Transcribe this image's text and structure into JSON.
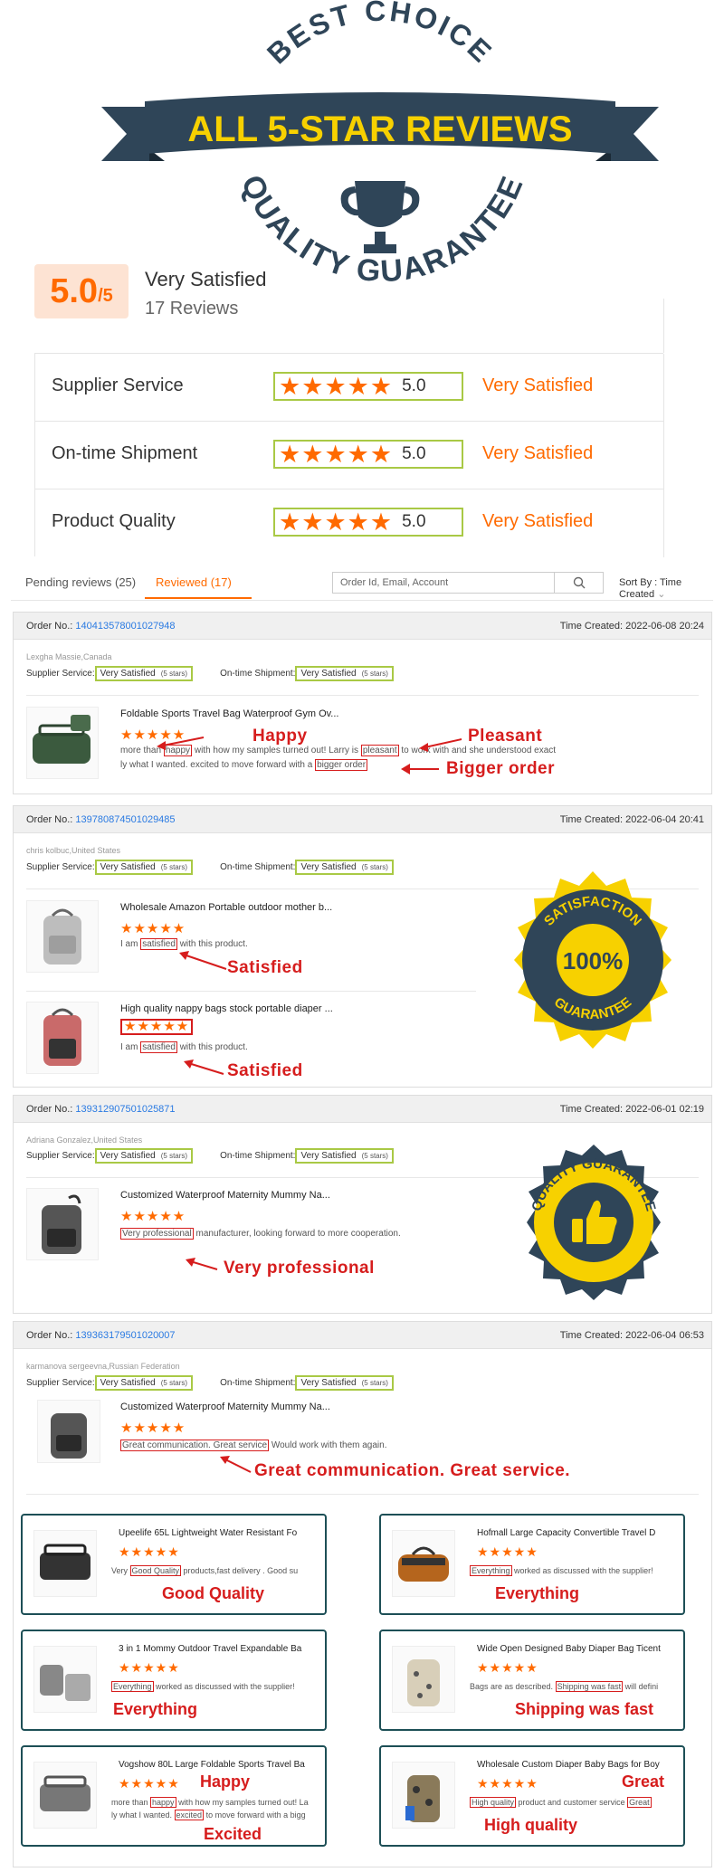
{
  "banner": {
    "arc_top": "BEST CHOICE",
    "ribbon": "ALL 5-STAR REVIEWS",
    "arc_bottom": "QUALITY GUARANTEE"
  },
  "summary": {
    "score": "5.0",
    "out_of": "/5",
    "label": "Very Satisfied",
    "count": "17 Reviews",
    "rows": [
      {
        "label": "Supplier Service",
        "value": "5.0",
        "word": "Very Satisfied",
        "stars": 5
      },
      {
        "label": "On-time Shipment",
        "value": "5.0",
        "word": "Very Satisfied",
        "stars": 5
      },
      {
        "label": "Product Quality",
        "value": "5.0",
        "word": "Very Satisfied",
        "stars": 5
      }
    ]
  },
  "toolbar": {
    "tab_pending": "Pending reviews (25)",
    "tab_reviewed": "Reviewed (17)",
    "search_placeholder": "Order Id, Email, Account",
    "sort_label": "Sort By : Time Created"
  },
  "common": {
    "order_no_label": "Order No.:",
    "time_label": "Time Created:",
    "supplier_service": "Supplier Service:",
    "ontime": "On-time Shipment:",
    "very_satisfied": "Very Satisfied",
    "five_stars": "(5 stars)",
    "stars": "★★★★★"
  },
  "orders": [
    {
      "id": "140413578001027948",
      "time": "2022-06-08 20:24",
      "buyer": "Lexgha Massie,Canada",
      "products": [
        {
          "title": "Foldable Sports Travel Bag Waterproof Gym Ov...",
          "t1a": "more than ",
          "h1": "happy",
          "t1b": " with how my samples turned out! Larry is ",
          "h2": "pleasant",
          "t1c": " to work with and she understood exact",
          "t2a": "ly what I wanted. excited to move forward with a ",
          "h3": "bigger order"
        }
      ],
      "annos": [
        "Happy",
        "Pleasant",
        "Bigger order"
      ]
    },
    {
      "id": "139780874501029485",
      "time": "2022-06-04 20:41",
      "buyer": "chris kolbuc,United States",
      "products": [
        {
          "title": "Wholesale Amazon Portable outdoor mother b...",
          "ta": "I am ",
          "h1": "satisfied",
          "tb": " with this product."
        },
        {
          "title": "High quality nappy bags stock portable diaper ...",
          "ta": "I am ",
          "h1": "satisfied",
          "tb": " with this product."
        }
      ],
      "annos": [
        "Satisfied",
        "Satisfied"
      ],
      "badge": {
        "top": "SATISFACTION",
        "mid": "100%",
        "bottom": "GUARANTEE"
      }
    },
    {
      "id": "139312907501025871",
      "time": "2022-06-01 02:19",
      "buyer": "Adriana Gonzalez,United States",
      "products": [
        {
          "title": "Customized Waterproof Maternity Mummy Na...",
          "h1": "Very professional",
          "tb": " manufacturer, looking forward to more cooperation."
        }
      ],
      "annos": [
        "Very professional"
      ],
      "badge": {
        "text": "QUALITY GUARANTEE"
      }
    },
    {
      "id": "139363179501020007",
      "time": "2022-06-04 06:53",
      "buyer": "karmanova sergeevna,Russian Federation",
      "products": [
        {
          "title": "Customized Waterproof Maternity Mummy Na...",
          "h1": "Great communication. Great service",
          "tb": " Would work with them again."
        }
      ],
      "annos": [
        "Great communication. Great service."
      ]
    }
  ],
  "mini_cards": [
    {
      "title": "Upeelife 65L Lightweight Water Resistant Fo",
      "pre": "Very ",
      "hl": "Good Quality",
      "post": " products,fast delivery . Good su",
      "anno": "Good Quality"
    },
    {
      "title": "Hofmall Large Capacity Convertible Travel D",
      "pre": "",
      "hl": "Everything",
      "post": " worked as discussed with the supplier!",
      "anno": "Everything"
    },
    {
      "title": "3 in 1 Mommy Outdoor Travel Expandable Ba",
      "pre": "",
      "hl": "Everything",
      "post": " worked as discussed with the supplier!",
      "anno": "Everything"
    },
    {
      "title": "Wide Open Designed Baby Diaper Bag Ticent",
      "pre": "Bags are as described. ",
      "hl": "Shipping was fast",
      "post": " will defini",
      "anno": "Shipping was fast"
    },
    {
      "title": "Vogshow 80L Large Foldable Sports Travel Ba",
      "pre": "more than ",
      "hl": "happy",
      "post": " with how my samples turned out! La",
      "line2_pre": "ly what I wanted. ",
      "hl2": "excited",
      "line2_post": " to move forward with a bigg",
      "anno": "Happy",
      "anno2": "Excited"
    },
    {
      "title": "Wholesale Custom Diaper Baby Bags for Boy",
      "pre": "",
      "hl": "High quality",
      "post": " product and customer service ",
      "hl2": "Great",
      "anno": "High quality",
      "anno2": "Great"
    }
  ],
  "colors": {
    "accent": "#ff6a00",
    "red": "#d61d1d",
    "navy": "#2f4558",
    "gold": "#f7d100",
    "teal": "#1d4f56",
    "green": "#a9c945"
  }
}
